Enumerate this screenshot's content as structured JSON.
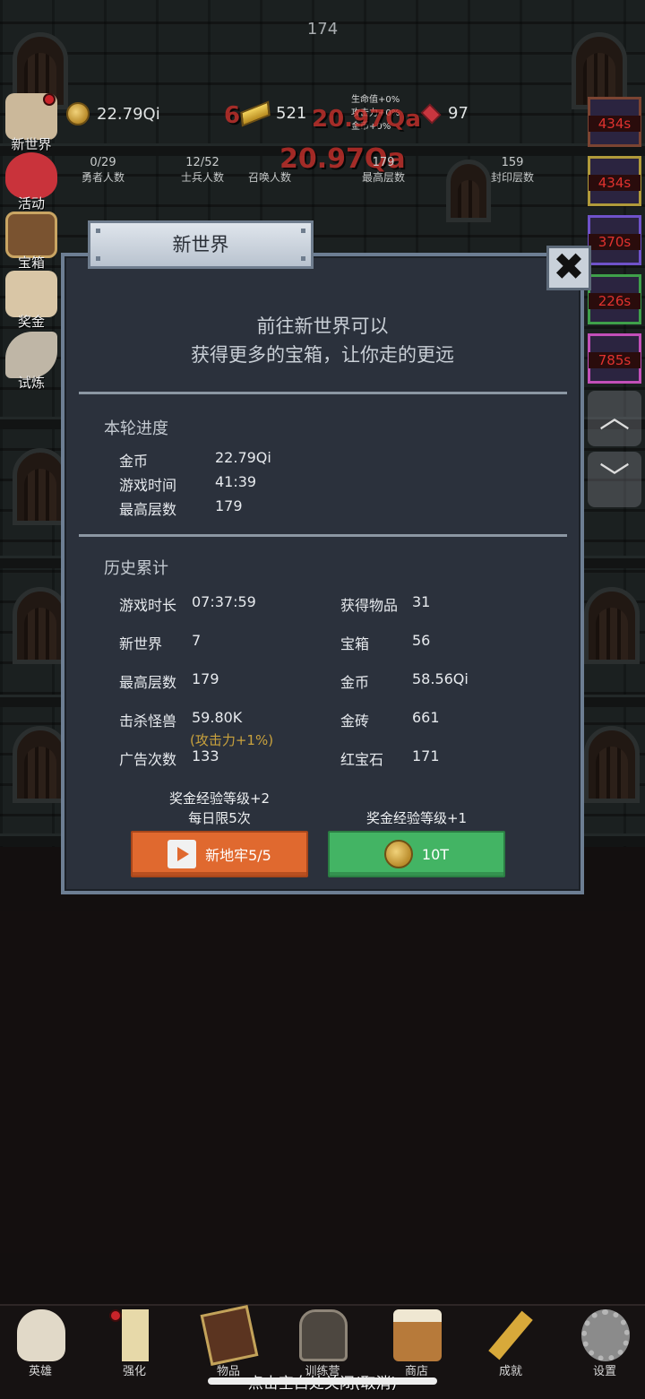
{
  "hud": {
    "floor": "174",
    "gold": "22.79Qi",
    "gold_bars": "521",
    "rubies": "97",
    "buffs": [
      "生命值+0%",
      "攻击力+0%",
      "金币+0%"
    ],
    "counters": [
      {
        "value": "0/29",
        "label": "勇者人数"
      },
      {
        "value": "12/52",
        "label": "士兵人数"
      },
      {
        "value": "",
        "label": "召唤人数"
      },
      {
        "value": "179",
        "label": "最高层数"
      },
      {
        "value": "159",
        "label": "封印层数"
      }
    ],
    "damage_popups": [
      "20.97Qa",
      "20.97Qa",
      "6"
    ]
  },
  "side_menu": {
    "items": [
      {
        "label": "新世界"
      },
      {
        "label": "活动"
      },
      {
        "label": "宝箱"
      },
      {
        "label": "奖金"
      },
      {
        "label": "试炼"
      }
    ]
  },
  "timers": [
    "434s",
    "434s",
    "370s",
    "226s",
    "785s"
  ],
  "modal": {
    "title": "新世界",
    "close_label": "✖",
    "intro_line1": "前往新世界可以",
    "intro_line2": "获得更多的宝箱，让你走的更远",
    "current": {
      "title": "本轮进度",
      "rows": [
        {
          "label": "金币",
          "value": "22.79Qi"
        },
        {
          "label": "游戏时间",
          "value": "41:39"
        },
        {
          "label": "最高层数",
          "value": "179"
        }
      ]
    },
    "history": {
      "title": "历史累计",
      "left": [
        {
          "label": "游戏时长",
          "value": "07:37:59"
        },
        {
          "label": "新世界",
          "value": "7"
        },
        {
          "label": "最高层数",
          "value": "179"
        },
        {
          "label": "击杀怪兽",
          "value": "59.80K",
          "sub": "(攻击力+1%)"
        },
        {
          "label": "广告次数",
          "value": "133"
        }
      ],
      "right": [
        {
          "label": "获得物品",
          "value": "31"
        },
        {
          "label": "宝箱",
          "value": "56"
        },
        {
          "label": "金币",
          "value": "58.56Qi"
        },
        {
          "label": "金砖",
          "value": "661"
        },
        {
          "label": "红宝石",
          "value": "171"
        }
      ]
    },
    "ad_note_line1": "奖金经验等级+2",
    "ad_note_line2": "每日限5次",
    "coin_note": "奖金经验等级+1",
    "ad_button": "新地牢5/5",
    "coin_button": "10T"
  },
  "bottom_nav": {
    "items": [
      {
        "label": "英雄"
      },
      {
        "label": "强化"
      },
      {
        "label": "物品"
      },
      {
        "label": "训练营"
      },
      {
        "label": "商店"
      },
      {
        "label": "成就"
      },
      {
        "label": "设置"
      }
    ]
  },
  "close_hint": "点击空白处关闭(取消)"
}
